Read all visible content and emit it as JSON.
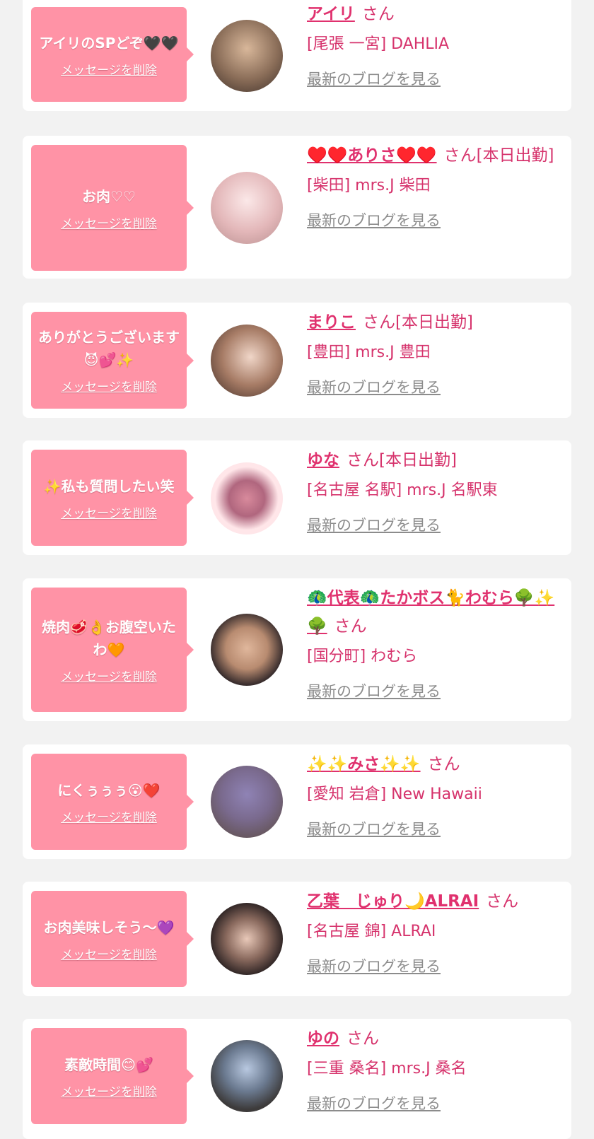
{
  "messages": [
    {
      "bubble_text": "アイリのSPどぞ🖤🖤",
      "delete_label": "メッセージを削除",
      "name": "アイリ",
      "suffix": "さん",
      "shop": "[尾張 一宮] DAHLIA",
      "blog_link": "最新のブログを見る",
      "avatar_icon": "avatar-photo",
      "avatar_color": "#6b5a4e"
    },
    {
      "bubble_text": "お肉♡♡",
      "delete_label": "メッセージを削除",
      "name": "♥️♥️ありさ♥️♥️",
      "suffix": "さん[本日出勤]",
      "shop": "[柴田] mrs.J 柴田",
      "blog_link": "最新のブログを見る",
      "avatar_icon": "avatar-photo",
      "avatar_color": "#e9c7c7"
    },
    {
      "bubble_text": "ありがとうございます😈💕✨",
      "delete_label": "メッセージを削除",
      "name": "まりこ",
      "suffix": "さん[本日出勤]",
      "shop": "[豊田] mrs.J 豊田",
      "blog_link": "最新のブログを見る",
      "avatar_icon": "avatar-photo",
      "avatar_color": "#7a5a4a"
    },
    {
      "bubble_text": "✨私も質問したい笑",
      "delete_label": "メッセージを削除",
      "name": "ゆな",
      "suffix": "さん[本日出勤]",
      "shop": "[名古屋 名駅] mrs.J 名駅東",
      "blog_link": "最新のブログを見る",
      "avatar_icon": "avatar-photo",
      "avatar_color": "#ffe6e9"
    },
    {
      "bubble_text": "焼肉🥩👌お腹空いたわ🧡",
      "delete_label": "メッセージを削除",
      "name": "🦚代表🦚たかボス🐈わむら🌳✨🌳",
      "suffix": "さん",
      "shop": "[国分町] わむら",
      "blog_link": "最新のブログを見る",
      "avatar_icon": "avatar-photo",
      "avatar_color": "#3a2e2e"
    },
    {
      "bubble_text": "にくぅぅぅ😮❤️",
      "delete_label": "メッセージを削除",
      "name": "✨✨みさ✨✨",
      "suffix": "さん",
      "shop": "[愛知 岩倉] New Hawaii",
      "blog_link": "最新のブログを見る",
      "avatar_icon": "avatar-photo",
      "avatar_color": "#8a7b9e"
    },
    {
      "bubble_text": "お肉美味しそう〜💜",
      "delete_label": "メッセージを削除",
      "name": "乙葉　じゅり🌙ALRAI",
      "suffix": "さん",
      "shop": "[名古屋 錦] ALRAI",
      "blog_link": "最新のブログを見る",
      "avatar_icon": "avatar-photo",
      "avatar_color": "#2e2424"
    },
    {
      "bubble_text": "素敵時間😊💕",
      "delete_label": "メッセージを削除",
      "name": "ゆの",
      "suffix": "さん",
      "shop": "[三重 桑名] mrs.J 桑名",
      "blog_link": "最新のブログを見る",
      "avatar_icon": "avatar-photo",
      "avatar_color": "#3d3b3b"
    }
  ]
}
